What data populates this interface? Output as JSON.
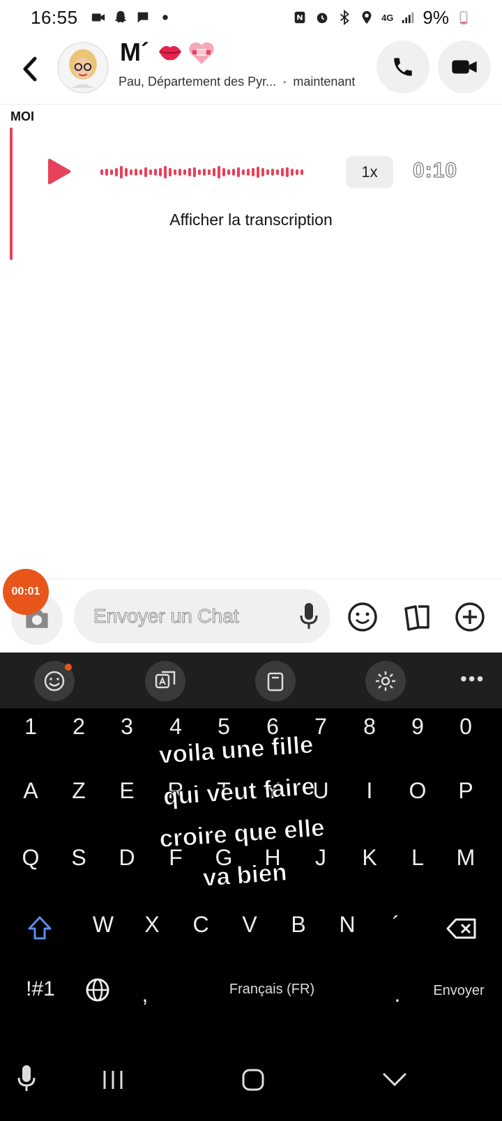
{
  "status_bar": {
    "time": "16:55",
    "battery": "9%",
    "network": "4G",
    "left_icons": [
      "video-icon",
      "snapchat-icon",
      "chat-bubble-icon",
      "dot-icon"
    ],
    "right_icons": [
      "nfc-icon",
      "alarm-icon",
      "bluetooth-icon",
      "location-icon",
      "signal-icon",
      "battery-icon"
    ]
  },
  "header": {
    "contact_name": "M´",
    "contact_emojis": [
      "💋",
      "💝"
    ],
    "location": "Pau, Département des Pyr...",
    "separator": "•",
    "last_seen": "maintenant"
  },
  "chat": {
    "sender_label": "MOI",
    "voice_note": {
      "speed": "1x",
      "duration": "0:10",
      "transcript_label": "Afficher la transcription"
    }
  },
  "input": {
    "placeholder": "Envoyer un Chat",
    "recording_timer": "00:01"
  },
  "keyboard": {
    "rows": {
      "numbers": [
        "1",
        "2",
        "3",
        "4",
        "5",
        "6",
        "7",
        "8",
        "9",
        "0"
      ],
      "row1": [
        "A",
        "Z",
        "E",
        "R",
        "T",
        "Y",
        "U",
        "I",
        "O",
        "P"
      ],
      "row2": [
        "Q",
        "S",
        "D",
        "F",
        "G",
        "H",
        "J",
        "K",
        "L",
        "M"
      ],
      "row3": [
        "W",
        "X",
        "C",
        "V",
        "B",
        "N",
        "´"
      ]
    },
    "symbols_key": "!#1",
    "comma_key": ",",
    "space_label": "Français (FR)",
    "period_key": ".",
    "send_key": "Envoyer"
  },
  "overlay_caption": {
    "lines": [
      "voila une fille",
      "qui veut faire",
      "croire que elle",
      "va bien"
    ]
  },
  "colors": {
    "accent": "#e8415b",
    "recording": "#e8561b",
    "keyboard_bg": "#000000",
    "toolbar_bg": "#1f1f1f"
  }
}
